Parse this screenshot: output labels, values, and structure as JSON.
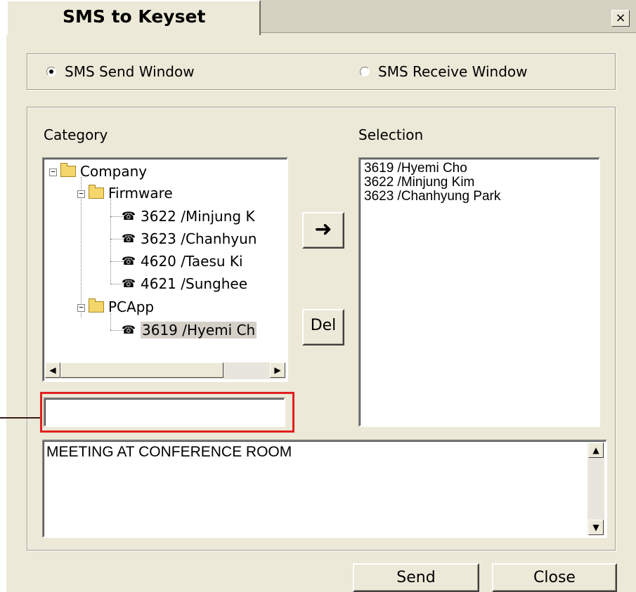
{
  "window": {
    "tab_title": "SMS to Keyset",
    "close_glyph": "×"
  },
  "mode": {
    "send_label": "SMS Send Window",
    "receive_label": "SMS Receive Window",
    "selected": "send"
  },
  "category": {
    "label": "Category",
    "tree": [
      {
        "text": "Company",
        "type": "folder",
        "expanded": true
      },
      {
        "text": "Firmware",
        "type": "folder",
        "expanded": true
      },
      {
        "text": "3622 /Minjung K",
        "type": "phone"
      },
      {
        "text": "3623 /Chanhyun",
        "type": "phone"
      },
      {
        "text": "4620 /Taesu Ki",
        "type": "phone"
      },
      {
        "text": "4621 /Sunghee",
        "type": "phone"
      },
      {
        "text": "PCApp",
        "type": "folder",
        "expanded": true
      },
      {
        "text": "3619 /Hyemi Ch",
        "type": "phone",
        "selected": true
      }
    ]
  },
  "selection": {
    "label": "Selection",
    "items": [
      "3619 /Hyemi Cho",
      "3622 /Minjung Kim",
      "3623 /Chanhyung Park"
    ]
  },
  "buttons": {
    "add_glyph": "➜",
    "delete_label": "Del",
    "send_label": "Send",
    "close_label": "Close"
  },
  "search_input": {
    "value": "",
    "placeholder": ""
  },
  "message": {
    "text": "MEETING AT CONFERENCE ROOM"
  },
  "icons": {
    "folder": "folder-icon",
    "phone": "phone-extension-icon",
    "minus": "⊟",
    "arrow_left": "◀",
    "arrow_right": "▶",
    "arrow_up": "▲",
    "arrow_down": "▼"
  },
  "colors": {
    "dialog_bg": "#ece9d8",
    "highlight_box": "#e02020"
  }
}
